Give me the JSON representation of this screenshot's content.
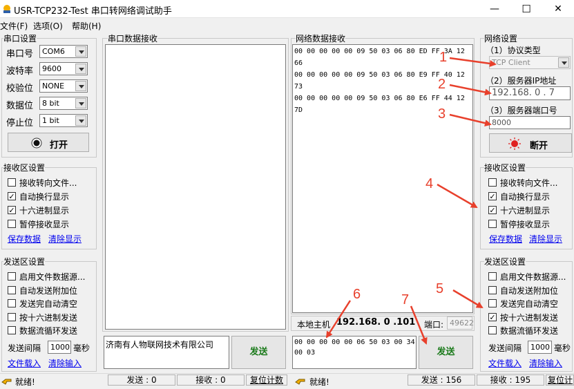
{
  "window": {
    "title": "USR-TCP232-Test 串口转网络调试助手",
    "minimize": "—",
    "maximize": "☐",
    "close": "✕"
  },
  "menu": [
    "文件(F)",
    "选项(O)",
    "帮助(H)"
  ],
  "serial_settings": {
    "title": "串口设置",
    "port_label": "串口号",
    "port_value": "COM6",
    "baud_label": "波特率",
    "baud_value": "9600",
    "parity_label": "校验位",
    "parity_value": "NONE",
    "data_label": "数据位",
    "data_value": "8 bit",
    "stop_label": "停止位",
    "stop_value": "1 bit",
    "open_button": "打开"
  },
  "serial_receive_settings": {
    "title": "接收区设置",
    "options": [
      {
        "label": "接收转向文件...",
        "checked": false
      },
      {
        "label": "自动换行显示",
        "checked": true
      },
      {
        "label": "十六进制显示",
        "checked": true
      },
      {
        "label": "暂停接收显示",
        "checked": false
      }
    ],
    "save_link": "保存数据",
    "clear_link": "清除显示"
  },
  "serial_send_settings": {
    "title": "发送区设置",
    "options": [
      {
        "label": "启用文件数据源...",
        "checked": false
      },
      {
        "label": "自动发送附加位",
        "checked": false
      },
      {
        "label": "发送完自动清空",
        "checked": false
      },
      {
        "label": "按十六进制发送",
        "checked": false
      },
      {
        "label": "数据流循环发送",
        "checked": false
      }
    ],
    "interval_label": "发送间隔",
    "interval_value": "1000",
    "interval_unit": "毫秒",
    "load_link": "文件载入",
    "clear_link": "清除输入"
  },
  "serial_data": {
    "title": "串口数据接收",
    "send_text": "济南有人物联网技术有限公司",
    "send_button": "发送"
  },
  "network_data": {
    "title": "网络数据接收",
    "lines": [
      "00 00 00 00 00 09 50 03 06 80 ED FF 3A 12",
      "66",
      "00 00 00 00 00 09 50 03 06 80 E9 FF 40 12",
      "73",
      "00 00 00 00 00 09 50 03 06 80 E6 FF 44 12",
      "7D"
    ],
    "local_host_label": "本地主机",
    "local_host_value": "192.168. 0 .101",
    "port_label": "端口:",
    "port_value": "49622",
    "send_lines": [
      "00 00 00 00 00 06 50 03 00 34",
      "00 03"
    ],
    "send_button": "发送"
  },
  "network_settings": {
    "title": "网络设置",
    "protocol_label": "（1）协议类型",
    "protocol_value": "TCP Client",
    "server_ip_label": "（2）服务器IP地址",
    "server_ip_value": "192.168. 0 . 7",
    "server_port_label": "（3）服务器端口号",
    "server_port_value": "8000",
    "disconnect_button": "断开"
  },
  "network_receive_settings": {
    "title": "接收区设置",
    "options": [
      {
        "label": "接收转向文件...",
        "checked": false
      },
      {
        "label": "自动换行显示",
        "checked": true
      },
      {
        "label": "十六进制显示",
        "checked": true
      },
      {
        "label": "暂停接收显示",
        "checked": false
      }
    ],
    "save_link": "保存数据",
    "clear_link": "清除显示"
  },
  "network_send_settings": {
    "title": "发送区设置",
    "options": [
      {
        "label": "启用文件数据源...",
        "checked": false
      },
      {
        "label": "自动发送附加位",
        "checked": false
      },
      {
        "label": "发送完自动清空",
        "checked": false
      },
      {
        "label": "按十六进制发送",
        "checked": true
      },
      {
        "label": "数据流循环发送",
        "checked": false
      }
    ],
    "interval_label": "发送间隔",
    "interval_value": "1000",
    "interval_unit": "毫秒",
    "load_link": "文件载入",
    "clear_link": "清除输入"
  },
  "status": {
    "left_ready": "就绪!",
    "left_sent": "发送 : 0",
    "left_recv": "接收 : 0",
    "left_reset": "复位计数",
    "right_ready": "就绪!",
    "right_sent": "发送 : 156",
    "right_recv": "接收 : 195",
    "right_reset": "复位计"
  },
  "annotations": [
    "1",
    "2",
    "3",
    "4",
    "5",
    "6",
    "7"
  ],
  "colors": {
    "annotation": "#e8402c",
    "link": "#0000ee",
    "send_text": "#1a7a1a"
  }
}
